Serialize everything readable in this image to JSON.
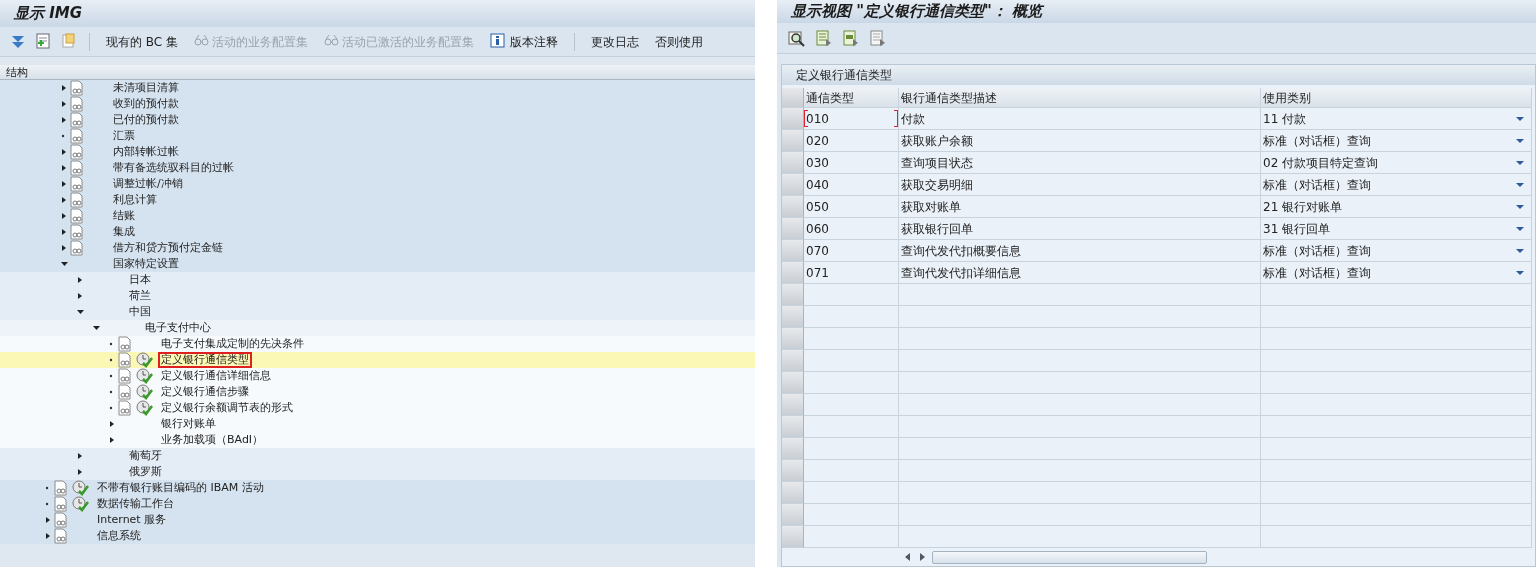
{
  "left": {
    "title": "显示 IMG",
    "toolbar": [
      {
        "kind": "icon"
      },
      {
        "kind": "icon"
      },
      {
        "kind": "icon"
      },
      {
        "kind": "separator"
      },
      {
        "kind": "button",
        "label": "现有的 BC 集",
        "disabled": false
      },
      {
        "kind": "icon-button",
        "label": "活动的业务配置集",
        "disabled": true
      },
      {
        "kind": "icon-button",
        "label": "活动已激活的业务配置集",
        "disabled": true
      },
      {
        "kind": "icon-button",
        "label": "版本注释",
        "disabled": false
      },
      {
        "kind": "separator"
      },
      {
        "kind": "button",
        "label": "更改日志",
        "disabled": false
      },
      {
        "kind": "button",
        "label": "否则使用",
        "disabled": false
      }
    ],
    "tree_header": "结构",
    "tree": [
      {
        "children": [
          {
            "label": "未清项目清算",
            "kind": "collapsed",
            "document": true,
            "activity": false,
            "selected": false
          },
          {
            "label": "收到的预付款",
            "kind": "collapsed",
            "document": true,
            "activity": false,
            "selected": false
          },
          {
            "label": "已付的预付款",
            "kind": "collapsed",
            "document": true,
            "activity": false,
            "selected": false
          },
          {
            "label": "汇票",
            "kind": "leaf",
            "document": true,
            "activity": false,
            "selected": false
          },
          {
            "label": "内部转帐过帐",
            "kind": "collapsed",
            "document": true,
            "activity": false,
            "selected": false
          },
          {
            "label": "带有备选统驭科目的过帐",
            "kind": "collapsed",
            "document": true,
            "activity": false,
            "selected": false
          },
          {
            "label": "调整过帐/冲销",
            "kind": "collapsed",
            "document": true,
            "activity": false,
            "selected": false
          },
          {
            "label": "利息计算",
            "kind": "collapsed",
            "document": true,
            "activity": false,
            "selected": false
          },
          {
            "label": "结账",
            "kind": "collapsed",
            "document": true,
            "activity": false,
            "selected": false
          },
          {
            "label": "集成",
            "kind": "collapsed",
            "document": true,
            "activity": false,
            "selected": false
          },
          {
            "label": "借方和贷方预付定金链",
            "kind": "collapsed",
            "document": true,
            "activity": false,
            "selected": false
          },
          {
            "label": "国家特定设置",
            "kind": "expanded",
            "document": false,
            "activity": false,
            "selected": false,
            "children": [
              {
                "label": "日本",
                "kind": "collapsed",
                "document": false,
                "activity": false,
                "selected": false
              },
              {
                "label": "荷兰",
                "kind": "collapsed",
                "document": false,
                "activity": false,
                "selected": false
              },
              {
                "label": "中国",
                "kind": "expanded",
                "document": false,
                "activity": false,
                "selected": false,
                "children": [
                  {
                    "label": "电子支付中心",
                    "kind": "expanded",
                    "document": false,
                    "activity": false,
                    "selected": false,
                    "children": [
                      {
                        "label": "电子支付集成定制的先决条件",
                        "kind": "leaf",
                        "document": true,
                        "activity": false,
                        "selected": false
                      },
                      {
                        "label": "定义银行通信类型",
                        "kind": "leaf",
                        "document": true,
                        "activity": true,
                        "selected": true,
                        "marked": true
                      },
                      {
                        "label": "定义银行通信详细信息",
                        "kind": "leaf",
                        "document": true,
                        "activity": true,
                        "selected": false
                      },
                      {
                        "label": "定义银行通信步骤",
                        "kind": "leaf",
                        "document": true,
                        "activity": true,
                        "selected": false
                      },
                      {
                        "label": "定义银行余额调节表的形式",
                        "kind": "leaf",
                        "document": true,
                        "activity": true,
                        "selected": false
                      },
                      {
                        "label": "银行对账单",
                        "kind": "collapsed",
                        "document": false,
                        "activity": false,
                        "selected": false
                      },
                      {
                        "label": "业务加载项（BAdI）",
                        "kind": "collapsed",
                        "document": false,
                        "activity": false,
                        "selected": false
                      }
                    ]
                  }
                ]
              },
              {
                "label": "葡萄牙",
                "kind": "collapsed",
                "document": false,
                "activity": false,
                "selected": false
              },
              {
                "label": "俄罗斯",
                "kind": "collapsed",
                "document": false,
                "activity": false,
                "selected": false
              }
            ]
          }
        ]
      },
      {
        "label": "不带有银行账目编码的 IBAM 活动",
        "kind": "leaf",
        "document": true,
        "activity": true,
        "selected": false
      },
      {
        "label": "数据传输工作台",
        "kind": "leaf",
        "document": true,
        "activity": true,
        "selected": false
      },
      {
        "label": "Internet 服务",
        "kind": "collapsed",
        "document": true,
        "activity": false,
        "selected": false
      },
      {
        "label": "信息系统",
        "kind": "collapsed",
        "document": true,
        "activity": false,
        "selected": false
      }
    ]
  },
  "right": {
    "title": "显示视图 \"定义银行通信类型\"： 概览",
    "table": {
      "title": "定义银行通信类型",
      "columns": [
        "通信类型",
        "银行通信类型描述",
        "使用类别"
      ],
      "rows": [
        {
          "code": "010",
          "description": "付款",
          "usage": "11  付款",
          "focused": true
        },
        {
          "code": "020",
          "description": "获取账户余额",
          "usage": "标准（对话框）查询",
          "focused": false
        },
        {
          "code": "030",
          "description": "查询项目状态",
          "usage": "02  付款项目特定查询",
          "focused": false
        },
        {
          "code": "040",
          "description": "获取交易明细",
          "usage": "标准（对话框）查询",
          "focused": false
        },
        {
          "code": "050",
          "description": "获取对账单",
          "usage": "21  银行对账单",
          "focused": false
        },
        {
          "code": "060",
          "description": "获取银行回单",
          "usage": "31  银行回单",
          "focused": false
        },
        {
          "code": "070",
          "description": "查询代发代扣概要信息",
          "usage": "标准（对话框）查询",
          "focused": false
        },
        {
          "code": "071",
          "description": "查询代发代扣详细信息",
          "usage": "标准（对话框）查询",
          "focused": false
        }
      ]
    }
  }
}
